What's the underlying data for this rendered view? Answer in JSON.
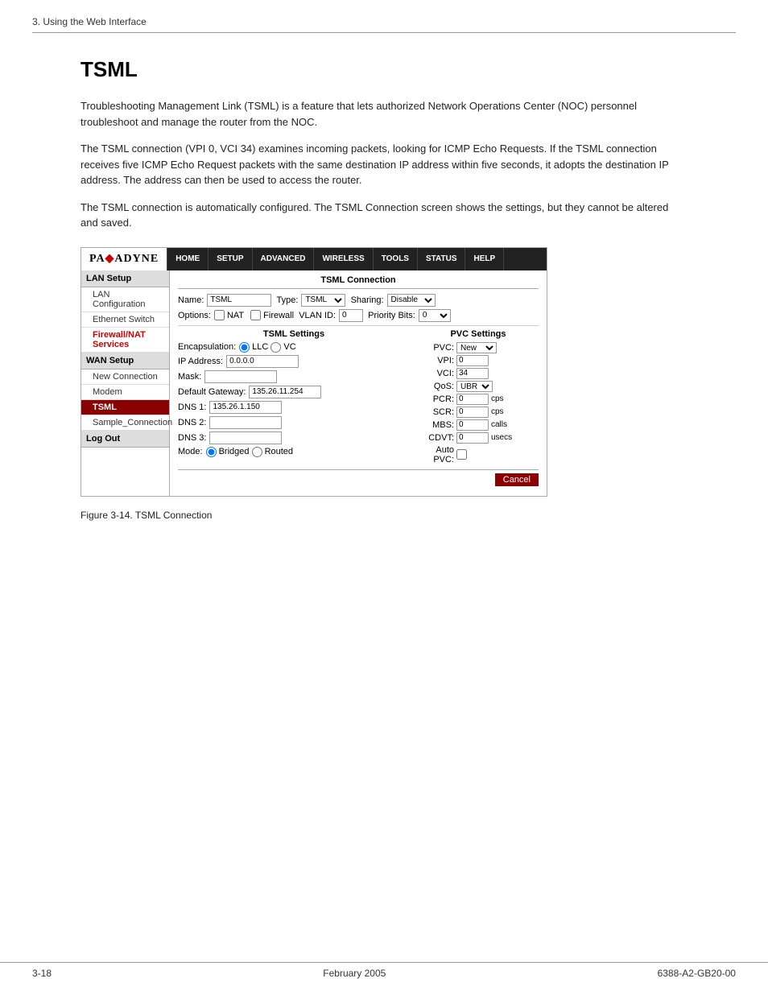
{
  "header": {
    "breadcrumb": "3. Using the Web Interface"
  },
  "page": {
    "title": "TSML",
    "intro1": "Troubleshooting Management Link (TSML) is a feature that lets authorized Network Operations Center (NOC) personnel troubleshoot and manage the router from the NOC.",
    "intro2": "The TSML connection (VPI 0, VCI 34) examines incoming packets, looking for ICMP Echo Requests. If the TSML connection receives five ICMP Echo Request packets with the same destination IP address within five seconds, it adopts the destination IP address. The address can then be used to access the router.",
    "intro3": "The TSML connection is automatically configured. The TSML Connection screen shows the settings, but they cannot be altered and saved."
  },
  "nav": {
    "logo": "PA•ADYNE",
    "items": [
      "HOME",
      "SETUP",
      "ADVANCED",
      "WIRELESS",
      "TOOLS",
      "STATUS",
      "HELP"
    ]
  },
  "sidebar": {
    "sections": [
      {
        "label": "LAN Setup",
        "items": [
          {
            "label": "LAN Configuration",
            "active": false,
            "red": false
          },
          {
            "label": "Ethernet Switch",
            "active": false,
            "red": false
          },
          {
            "label": "Firewall/NAT Services",
            "active": false,
            "red": false
          }
        ]
      },
      {
        "label": "WAN Setup",
        "items": [
          {
            "label": "New Connection",
            "active": false,
            "red": false
          },
          {
            "label": "Modem",
            "active": false,
            "red": false
          },
          {
            "label": "TSML",
            "active": true,
            "red": false
          },
          {
            "label": "Sample_Connection",
            "active": false,
            "red": false
          }
        ]
      },
      {
        "label": "Log Out",
        "items": []
      }
    ]
  },
  "panel": {
    "title": "TSML Connection",
    "name_label": "Name:",
    "name_value": "TSML",
    "type_label": "Type:",
    "type_value": "TSML",
    "sharing_label": "Sharing:",
    "sharing_value": "Disable",
    "options_label": "Options:",
    "nat_label": "NAT",
    "firewall_label": "Firewall",
    "vlan_id_label": "VLAN ID:",
    "vlan_id_value": "0",
    "priority_bits_label": "Priority Bits:",
    "priority_bits_value": "0",
    "tsml_settings_title": "TSML Settings",
    "encapsulation_label": "Encapsulation:",
    "encap_llc": "LLC",
    "encap_vc": "VC",
    "ip_address_label": "IP Address:",
    "ip_address_value": "0.0.0.0",
    "mask_label": "Mask:",
    "mask_value": "",
    "default_gateway_label": "Default Gateway:",
    "default_gateway_value": "135.26.11.254",
    "dns1_label": "DNS 1:",
    "dns1_value": "135.26.1.150",
    "dns2_label": "DNS 2:",
    "dns2_value": "",
    "dns3_label": "DNS 3:",
    "dns3_value": "",
    "mode_label": "Mode:",
    "mode_bridged": "Bridged",
    "mode_routed": "Routed",
    "pvc_title": "PVC Settings",
    "pvc_label": "PVC:",
    "pvc_value": "New",
    "vpi_label": "VPI:",
    "vpi_value": "0",
    "vci_label": "VCI:",
    "vci_value": "34",
    "qos_label": "QoS:",
    "qos_value": "UBR",
    "pcr_label": "PCR:",
    "pcr_value": "0",
    "pcr_unit": "cps",
    "scr_label": "SCR:",
    "scr_value": "0",
    "scr_unit": "cps",
    "mbs_label": "MBS:",
    "mbs_value": "0",
    "mbs_unit": "calls",
    "cdvt_label": "CDVT:",
    "cdvt_value": "0",
    "cdvt_unit": "usecs",
    "auto_pvc_label": "Auto PVC:",
    "cancel_label": "Cancel"
  },
  "figure_caption": "Figure 3-14.    TSML Connection",
  "footer": {
    "page_num": "3-18",
    "date": "February 2005",
    "doc_num": "6388-A2-GB20-00"
  }
}
